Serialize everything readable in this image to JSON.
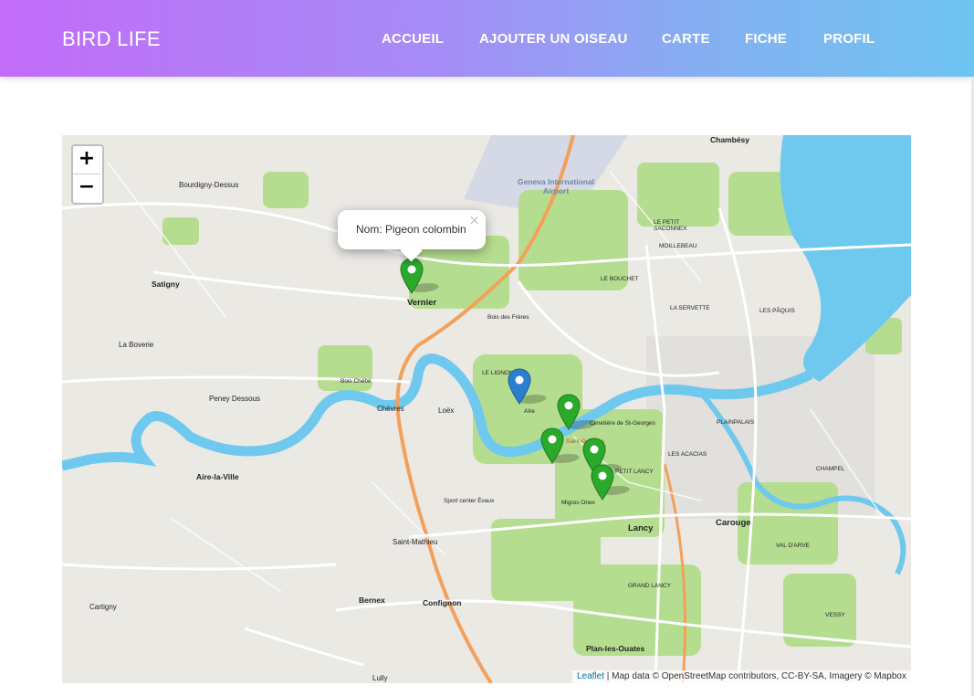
{
  "app": {
    "brand": "BIRD LIFE"
  },
  "nav": {
    "items": [
      "ACCUEIL",
      "AJOUTER UN OISEAU",
      "CARTE",
      "FICHE",
      "PROFIL"
    ]
  },
  "map": {
    "zoom_in": "+",
    "zoom_out": "−",
    "popup": {
      "text": "Nom: Pigeon colombin",
      "close": "×"
    },
    "attribution": {
      "leaflet": "Leaflet",
      "rest": " | Map data © OpenStreetMap contributors, CC-BY-SA, Imagery © Mapbox"
    },
    "marker_colors": {
      "green": "#2aa92a",
      "blue": "#2a7fcf"
    },
    "places": [
      "Chambésy",
      "Bourdigny-Dessus",
      "Satigny",
      "Vernier",
      "Geneva International Airport",
      "La Boverie",
      "Peney Dessous",
      "Chèvres",
      "Loëx",
      "Aire-la-Ville",
      "Saint-Mathieu",
      "Bernex",
      "Confignon",
      "Cartigny",
      "Plan-les-Ouates",
      "Lancy",
      "Carouge",
      "Lully",
      "LE PETIT SACONNEX",
      "MOILLEBEAU",
      "LES PÂQUIS",
      "PLAINPALAIS",
      "CHAMPEL",
      "LES ACACIAS",
      "PETIT LANCY",
      "GRAND LANCY",
      "VAL D'ARVE",
      "VESSY",
      "LE BOUCHET",
      "LA SERVETTE",
      "LE LIGNON",
      "Aïre",
      "Saint-Georges",
      "Bois des Frères",
      "Bois Chébé",
      "Sport center Évaux",
      "Cimetière de St-Georges",
      "Migros Onex"
    ]
  }
}
